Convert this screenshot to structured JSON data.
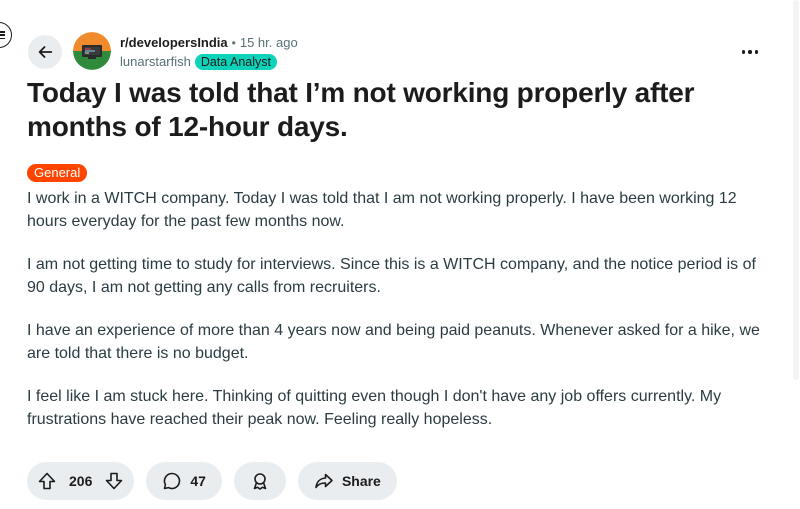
{
  "post": {
    "subreddit": "r/developersIndia",
    "separator": "•",
    "time_ago": "15 hr. ago",
    "author": "lunarstarfish",
    "user_flair": "Data Analyst",
    "title": "Today I was told that I’m not working properly after months of 12-hour days.",
    "post_flair": "General",
    "paragraphs": [
      "I work in a WITCH company. Today I was told that I am not working properly. I have been working 12 hours everyday for the past few months now.",
      "I am not getting time to study for interviews. Since this is a WITCH company, and the notice period is of 90 days, I am not getting any calls from recruiters.",
      "I have an experience of more than 4 years now and being paid peanuts. Whenever asked for a hike, we are told that there is no budget.",
      "I feel like I am stuck here. Thinking of quitting even though I don't have any job offers currently. My frustrations have reached their peak now. Feeling really hopeless."
    ]
  },
  "actions": {
    "vote_count": "206",
    "comment_count": "47",
    "share_label": "Share"
  },
  "icons": {
    "back": "arrow-left-icon",
    "upvote": "arrow-up-icon",
    "downvote": "arrow-down-icon",
    "comment": "speech-bubble-icon",
    "award": "award-icon",
    "share": "share-arrow-icon",
    "overflow": "ellipsis-icon",
    "edge_menu": "hamburger-menu-icon"
  },
  "colors": {
    "post_flair_bg": "#ff4500",
    "user_flair_bg": "#0dd3bb",
    "pill_bg": "#eaedef",
    "meta_text": "#576f76"
  }
}
